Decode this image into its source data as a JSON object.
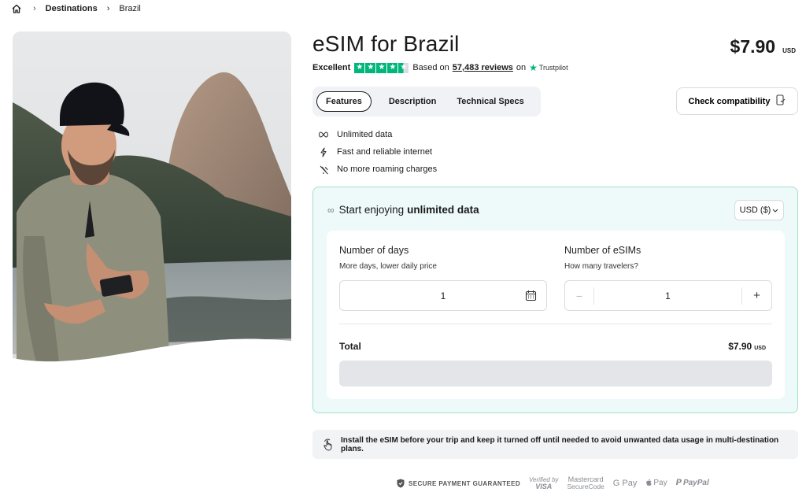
{
  "breadcrumb": {
    "home_icon": "home-icon",
    "items": [
      "Destinations",
      "Brazil"
    ]
  },
  "product": {
    "title": "eSIM for Brazil",
    "price": "$7.90",
    "currency": "USD"
  },
  "rating": {
    "label": "Excellent",
    "stars": 4.5,
    "based_on": "Based on",
    "reviews": "57,483 reviews",
    "on": "on",
    "provider": "Trustpilot",
    "star_color": "#00b67a"
  },
  "tabs": [
    {
      "label": "Features",
      "active": true
    },
    {
      "label": "Description",
      "active": false
    },
    {
      "label": "Technical Specs",
      "active": false
    }
  ],
  "check_compatibility": "Check compatibility",
  "features": [
    {
      "icon": "infinity-icon",
      "label": "Unlimited data"
    },
    {
      "icon": "lightning-icon",
      "label": "Fast and reliable internet"
    },
    {
      "icon": "no-roaming-icon",
      "label": "No more roaming charges"
    }
  ],
  "plan": {
    "heading_prefix": "Start enjoying",
    "heading_bold": "unlimited data",
    "currency_select": "USD ($)",
    "days": {
      "title": "Number of days",
      "subtitle": "More days, lower daily price",
      "value": "1"
    },
    "esims": {
      "title": "Number of eSIMs",
      "subtitle": "How many travelers?",
      "value": "1",
      "minus": "−",
      "plus": "+"
    },
    "total_label": "Total",
    "total_price": "$7.90",
    "total_currency": "USD"
  },
  "notice": "Install the eSIM before your trip and keep it turned off until needed to avoid unwanted data usage in multi-destination plans.",
  "payments": {
    "secure": "SECURE PAYMENT GUARANTEED",
    "visa_line1": "Verified by",
    "visa_line2": "VISA",
    "mc_line1": "Mastercard",
    "mc_line2": "SecureCode",
    "gpay": "G Pay",
    "apay": "Pay",
    "paypal": "PayPal"
  },
  "colors": {
    "accent_border": "#9ee3c6",
    "plan_bg": "#eef9f9"
  }
}
